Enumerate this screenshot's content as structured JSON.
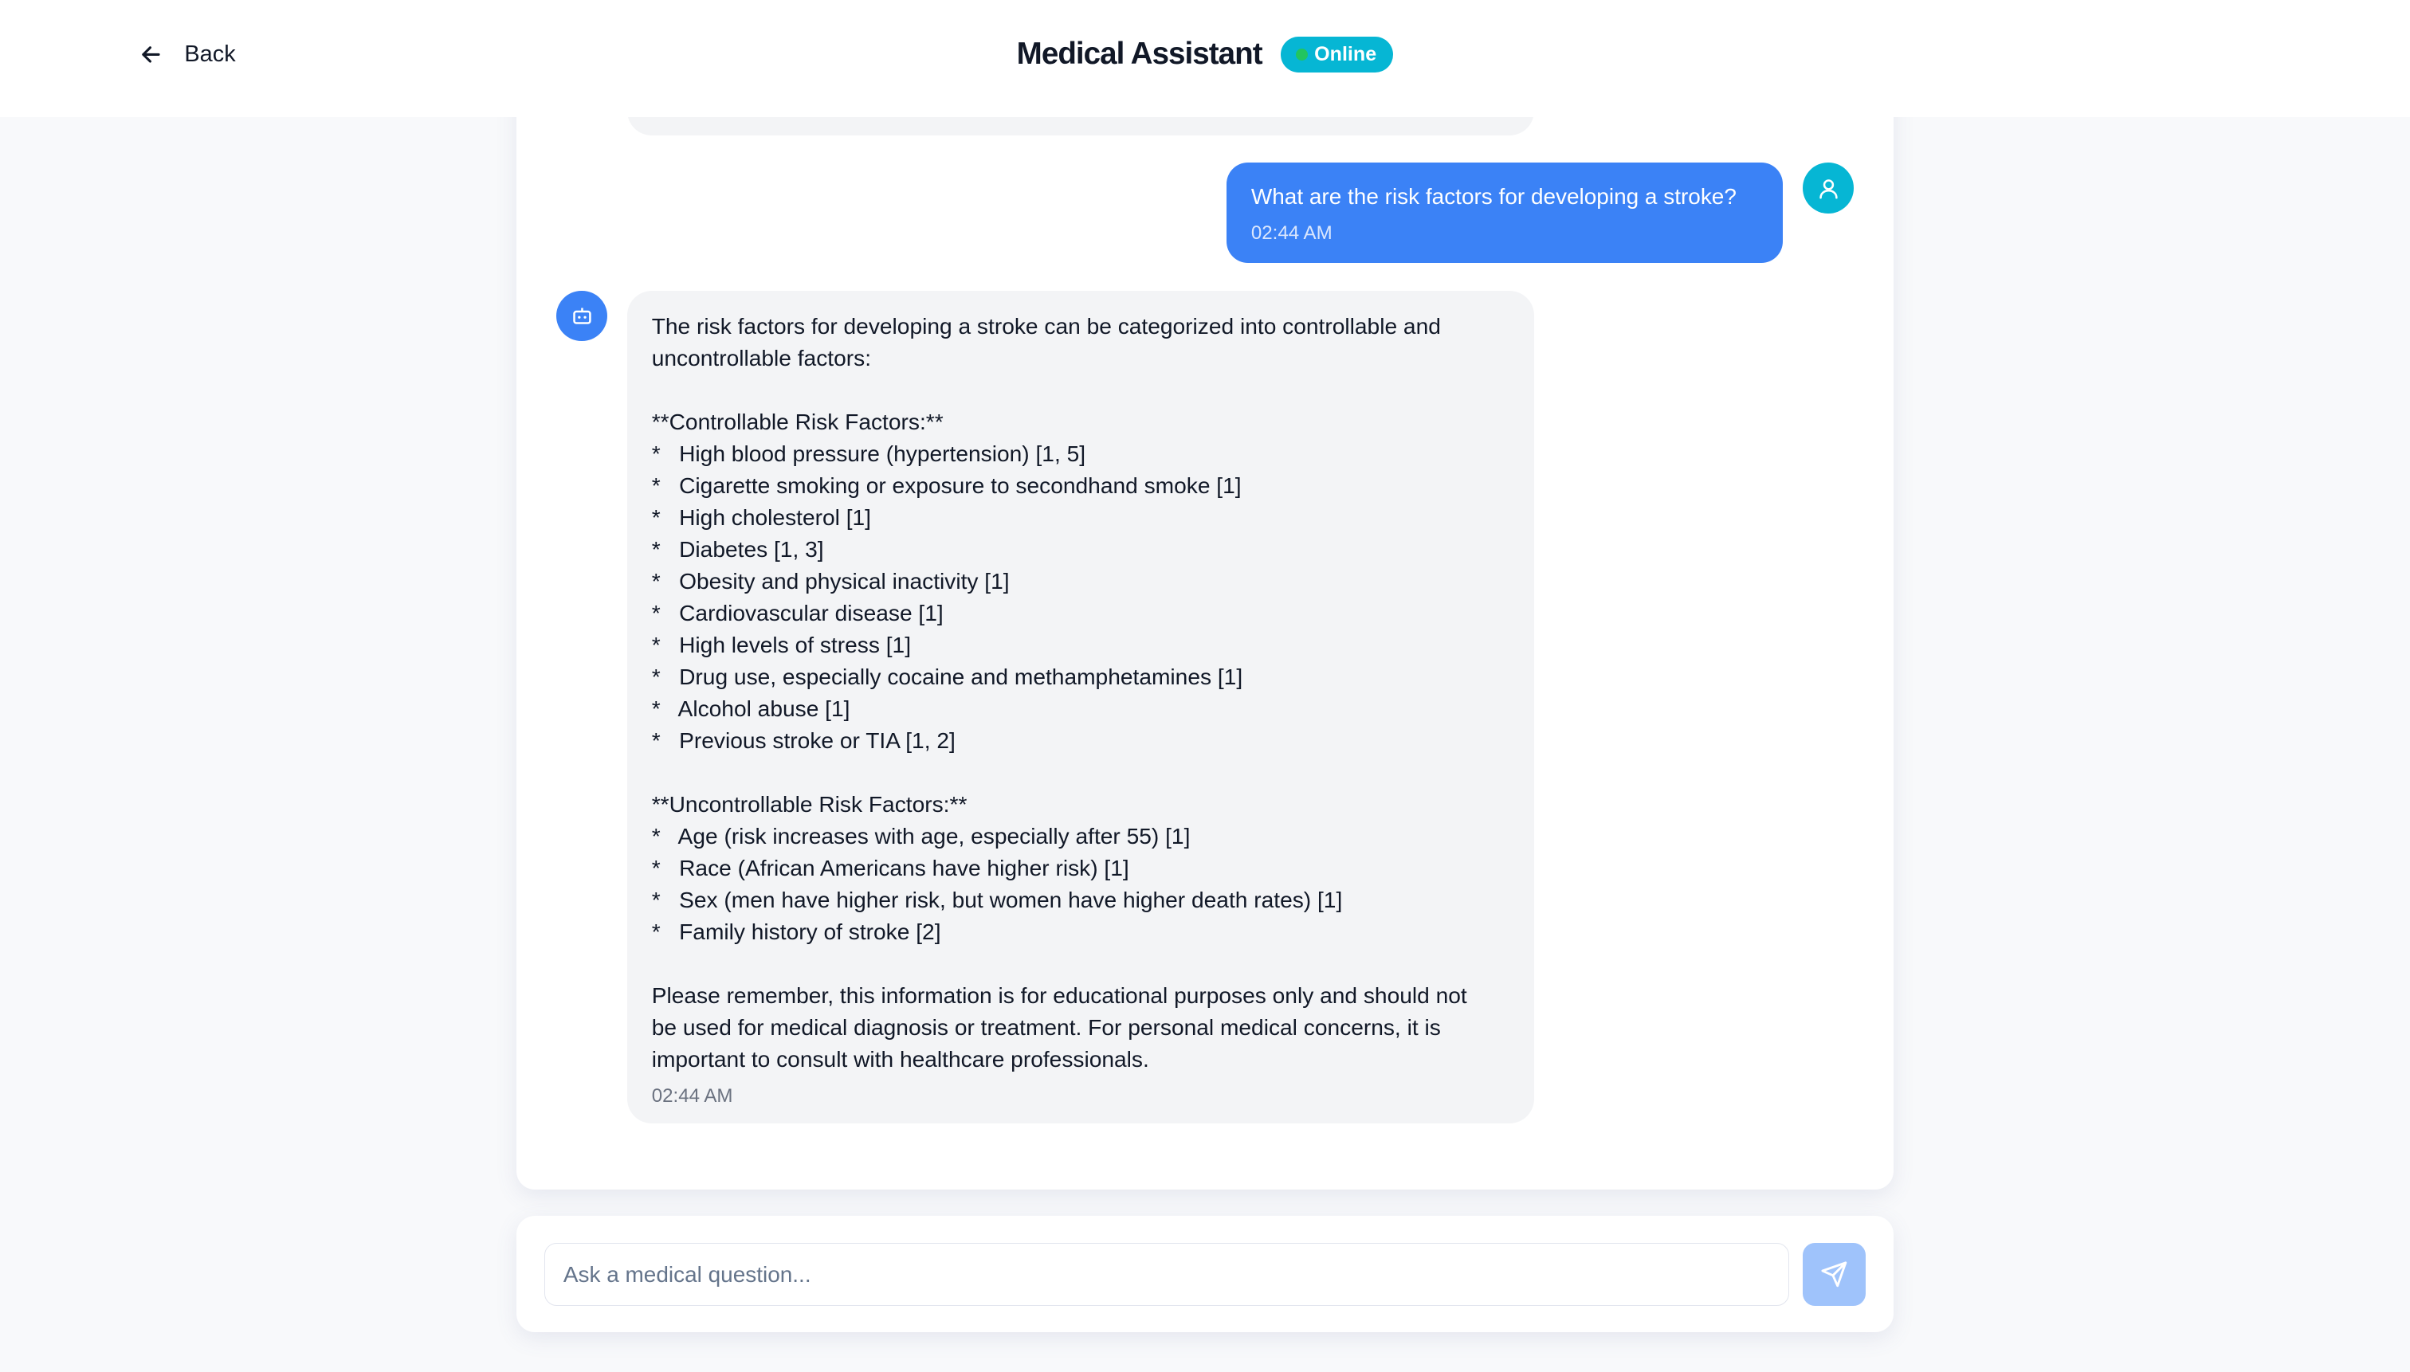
{
  "header": {
    "back_label": "Back",
    "title": "Medical Assistant",
    "status": "Online"
  },
  "colors": {
    "accent": "#3b82f6",
    "status": "#06b6d4",
    "online_dot": "#22c55e",
    "bot_bubble": "#f3f4f6"
  },
  "messages": [
    {
      "role": "user",
      "icon": "user-icon",
      "text": "What are the risk factors for developing a stroke?",
      "time": "02:44 AM"
    },
    {
      "role": "assistant",
      "icon": "bot-icon",
      "intro": [
        "The risk factors for developing a stroke can be categorized into controllable and",
        "uncontrollable factors:"
      ],
      "controllable_heading": "**Controllable Risk Factors:**",
      "controllable": [
        "*   High blood pressure (hypertension) [1, 5]",
        "*   Cigarette smoking or exposure to secondhand smoke [1]",
        "*   High cholesterol [1]",
        "*   Diabetes [1, 3]",
        "*   Obesity and physical inactivity [1]",
        "*   Cardiovascular disease [1]",
        "*   High levels of stress [1]",
        "*   Drug use, especially cocaine and methamphetamines [1]",
        "*   Alcohol abuse [1]",
        "*   Previous stroke or TIA [1, 2]"
      ],
      "uncontrollable_heading": "**Uncontrollable Risk Factors:**",
      "uncontrollable": [
        "*   Age (risk increases with age, especially after 55) [1]",
        "*   Race (African Americans have higher risk) [1]",
        "*   Sex (men have higher risk, but women have higher death rates) [1]",
        "*   Family history of stroke [2]"
      ],
      "disclaimer": [
        "Please remember, this information is for educational purposes only and should not",
        "be used for medical diagnosis or treatment. For personal medical concerns, it is",
        "important to consult with healthcare professionals."
      ],
      "time": "02:44 AM"
    }
  ],
  "composer": {
    "placeholder": "Ask a medical question...",
    "value": "",
    "send_icon": "send-icon"
  }
}
